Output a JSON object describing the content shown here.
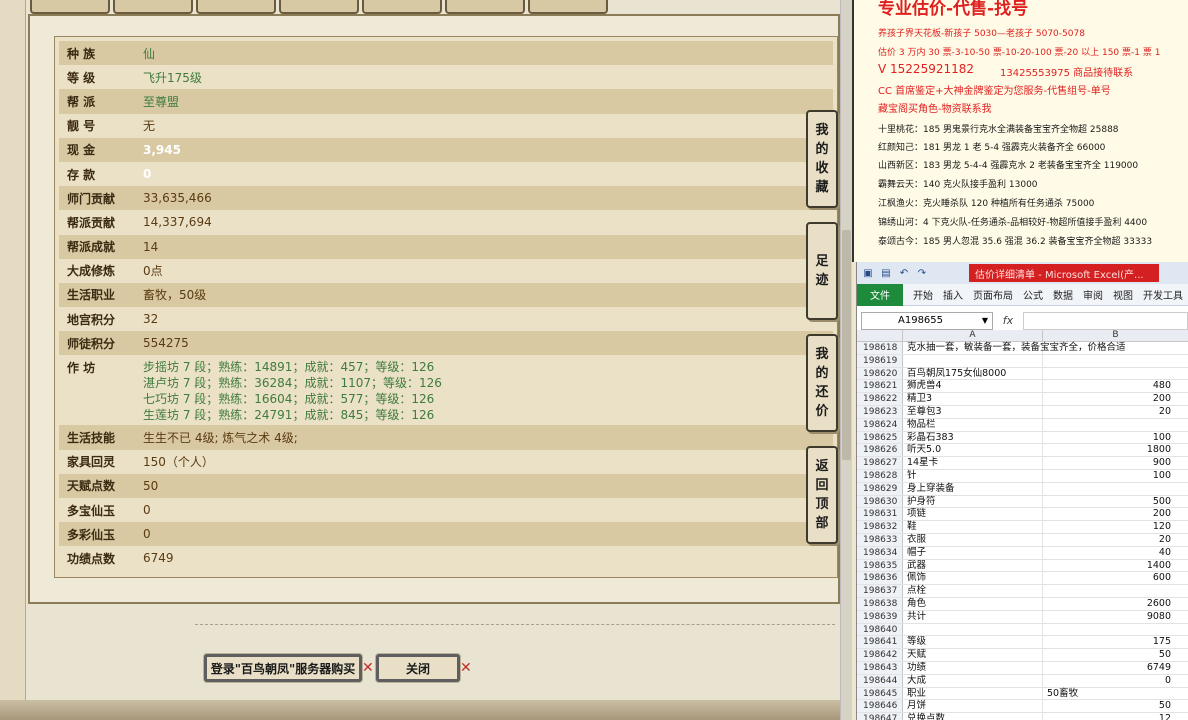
{
  "game": {
    "fields": [
      {
        "label": "种  族",
        "value": "仙",
        "color": "green"
      },
      {
        "label": "等  级",
        "value": "飞升175级",
        "color": "green"
      },
      {
        "label": "帮  派",
        "value": "至尊盟",
        "color": "green"
      },
      {
        "label": "靓  号",
        "value": "无",
        "color": "brown"
      },
      {
        "label": "现  金",
        "value": "3,945",
        "color": "white"
      },
      {
        "label": "存  款",
        "value": "0",
        "color": "white"
      },
      {
        "label": "师门贡献",
        "value": "33,635,466",
        "color": "brown"
      },
      {
        "label": "帮派贡献",
        "value": "14,337,694",
        "color": "brown"
      },
      {
        "label": "帮派成就",
        "value": "14",
        "color": "brown"
      },
      {
        "label": "大成修炼",
        "value": "0点",
        "color": "brown"
      }
    ],
    "fields2": [
      {
        "label": "生活职业",
        "value": "畜牧，50级",
        "color": "brown"
      },
      {
        "label": "地宫积分",
        "value": "32",
        "color": "brown"
      },
      {
        "label": "师徒积分",
        "value": "554275",
        "color": "brown"
      }
    ],
    "workshop": {
      "label": "作  坊",
      "lines": [
        "步摇坊 7 段；熟练：14891；成就：457；等级：126",
        "湛卢坊 7 段；熟练：36284；成就：1107；等级：126",
        "七巧坊 7 段；熟练：16604；成就：577；等级：126",
        "生莲坊 7 段；熟练：24791；成就：845；等级：126"
      ]
    },
    "fields3": [
      {
        "label": "生活技能",
        "value": "生生不已 4级; 炼气之术 4级;",
        "color": "brown"
      },
      {
        "label": "家具回灵",
        "value": "150（个人）",
        "color": "brown"
      },
      {
        "label": "天赋点数",
        "value": "50",
        "color": "brown"
      },
      {
        "label": "多宝仙玉",
        "value": "0",
        "color": "brown"
      },
      {
        "label": "多彩仙玉",
        "value": "0",
        "color": "brown"
      },
      {
        "label": "功绩点数",
        "value": "6749",
        "color": "brown"
      }
    ],
    "side_buttons": [
      {
        "text": "我的收藏"
      },
      {
        "text": "足迹"
      },
      {
        "text": "我的还价"
      },
      {
        "text": "返回顶部"
      }
    ],
    "login_button": "登录\"百鸟朝凤\"服务器购买",
    "close_button": "关闭"
  },
  "ad": {
    "title": "专业估价-代售-找号",
    "lines": [
      "养孩子界天花板-新孩子 5030—老孩子 5070-5078",
      "估价 3 万内 30 票-3-10-50 票-10-20-100 票-20 以上 150 票-1 票 1",
      "V 15225921182",
      "CC 首席鉴定+大神金牌鉴定为您服务-代售组号-单号",
      "藏宝阁买角色-物资联系我",
      "十里桃花：185 男鬼景行克水全满装备宝宝齐全物超 25888",
      "红颜知己：181 男龙 1 老 5-4 强霹克火装备齐全 66000",
      "山西新区：183 男龙 5-4-4 强霹克水 2 老装备宝宝齐全 119000",
      "霸舞云天：140 克火队接手盈利 13000",
      "江枫渔火：克火睡杀队 120 种植所有任务通杀 75000",
      "锦绣山河：4 下克火队-任务通杀-品相较好-物超所值接手盈利 4400",
      "泰颂古今：185 男人忽混 35.6 强混 36.2 装备宝宝齐全物超 33333"
    ],
    "phone2": "13425553975 商品接待联系"
  },
  "excel": {
    "title": "估价详细清单 - Microsoft Excel(产...",
    "file_tab": "文件",
    "tabs": [
      "开始",
      "插入",
      "页面布局",
      "公式",
      "数据",
      "审阅",
      "视图",
      "开发工具"
    ],
    "name_box": "A198655",
    "fx": "fx",
    "col_a": "A",
    "col_b": "B",
    "rows": [
      {
        "n": "198618",
        "a": "克水抽一套，敏装备一套，装备宝宝齐全，价格合适",
        "b": ""
      },
      {
        "n": "198619",
        "a": "",
        "b": ""
      },
      {
        "n": "198620",
        "a": "百鸟朝凤175女仙8000",
        "b": ""
      },
      {
        "n": "198621",
        "a": "狮虎兽4",
        "b": "480"
      },
      {
        "n": "198622",
        "a": "精卫3",
        "b": "200"
      },
      {
        "n": "198623",
        "a": "至尊包3",
        "b": "20"
      },
      {
        "n": "198624",
        "a": "物品栏",
        "b": ""
      },
      {
        "n": "198625",
        "a": "彩晶石383",
        "b": "100"
      },
      {
        "n": "198626",
        "a": "听天5.0",
        "b": "1800"
      },
      {
        "n": "198627",
        "a": "14星卡",
        "b": "900"
      },
      {
        "n": "198628",
        "a": "针",
        "b": "100"
      },
      {
        "n": "198629",
        "a": "身上穿装备",
        "b": ""
      },
      {
        "n": "198630",
        "a": "护身符",
        "b": "500"
      },
      {
        "n": "198631",
        "a": "项链",
        "b": "200"
      },
      {
        "n": "198632",
        "a": "鞋",
        "b": "120"
      },
      {
        "n": "198633",
        "a": "衣服",
        "b": "20"
      },
      {
        "n": "198634",
        "a": "帽子",
        "b": "40"
      },
      {
        "n": "198635",
        "a": "武器",
        "b": "1400"
      },
      {
        "n": "198636",
        "a": "佩饰",
        "b": "600"
      },
      {
        "n": "198637",
        "a": "点栓",
        "b": ""
      },
      {
        "n": "198638",
        "a": "角色",
        "b": "2600"
      },
      {
        "n": "198639",
        "a": "共计",
        "b": "9080"
      },
      {
        "n": "198640",
        "a": "",
        "b": ""
      },
      {
        "n": "198641",
        "a": "等级",
        "b": "175"
      },
      {
        "n": "198642",
        "a": "天赋",
        "b": "50"
      },
      {
        "n": "198643",
        "a": "功绩",
        "b": "6749"
      },
      {
        "n": "198644",
        "a": "大成",
        "b": "0"
      },
      {
        "n": "198645",
        "a": "职业",
        "b": "50畜牧",
        "b_left": true
      },
      {
        "n": "198646",
        "a": "月饼",
        "b": "50"
      },
      {
        "n": "198647",
        "a": "兑换点数",
        "b": "12"
      }
    ]
  },
  "colors": {
    "green": "#3e7c3e",
    "brown": "#5a3a12",
    "ad_red": "#e02020",
    "excel_green": "#1e8a3c"
  }
}
